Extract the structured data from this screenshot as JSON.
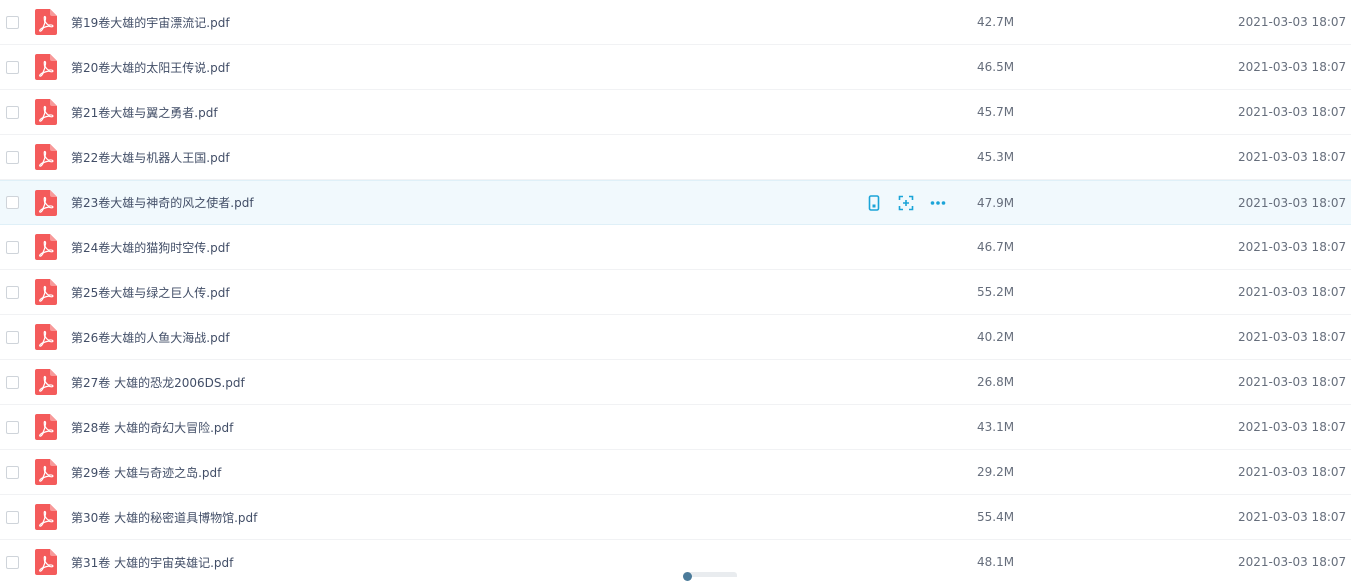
{
  "colors": {
    "pdf_icon": "#f45b5b",
    "action_icon": "#1ba4d8",
    "hover_row": "#f1f9fd"
  },
  "row_action_icons": [
    "phone-icon",
    "scan-icon",
    "more-icon"
  ],
  "files": [
    {
      "name": "第19卷大雄的宇宙漂流记.pdf",
      "size": "42.7M",
      "date": "2021-03-03 18:07",
      "icon": "pdf-icon"
    },
    {
      "name": "第20卷大雄的太阳王传说.pdf",
      "size": "46.5M",
      "date": "2021-03-03 18:07",
      "icon": "pdf-icon"
    },
    {
      "name": "第21卷大雄与翼之勇者.pdf",
      "size": "45.7M",
      "date": "2021-03-03 18:07",
      "icon": "pdf-icon"
    },
    {
      "name": "第22卷大雄与机器人王国.pdf",
      "size": "45.3M",
      "date": "2021-03-03 18:07",
      "icon": "pdf-icon"
    },
    {
      "name": "第23卷大雄与神奇的风之使者.pdf",
      "size": "47.9M",
      "date": "2021-03-03 18:07",
      "icon": "pdf-icon",
      "hovered": true
    },
    {
      "name": "第24卷大雄的猫狗时空传.pdf",
      "size": "46.7M",
      "date": "2021-03-03 18:07",
      "icon": "pdf-icon"
    },
    {
      "name": "第25卷大雄与绿之巨人传.pdf",
      "size": "55.2M",
      "date": "2021-03-03 18:07",
      "icon": "pdf-icon"
    },
    {
      "name": "第26卷大雄的人鱼大海战.pdf",
      "size": "40.2M",
      "date": "2021-03-03 18:07",
      "icon": "pdf-icon"
    },
    {
      "name": "第27卷 大雄的恐龙2006DS.pdf",
      "size": "26.8M",
      "date": "2021-03-03 18:07",
      "icon": "pdf-icon"
    },
    {
      "name": "第28卷 大雄的奇幻大冒险.pdf",
      "size": "43.1M",
      "date": "2021-03-03 18:07",
      "icon": "pdf-icon"
    },
    {
      "name": "第29卷 大雄与奇迹之岛.pdf",
      "size": "29.2M",
      "date": "2021-03-03 18:07",
      "icon": "pdf-icon"
    },
    {
      "name": "第30卷 大雄的秘密道具博物馆.pdf",
      "size": "55.4M",
      "date": "2021-03-03 18:07",
      "icon": "pdf-icon"
    },
    {
      "name": "第31卷 大雄的宇宙英雄记.pdf",
      "size": "48.1M",
      "date": "2021-03-03 18:07",
      "icon": "pdf-icon"
    }
  ]
}
